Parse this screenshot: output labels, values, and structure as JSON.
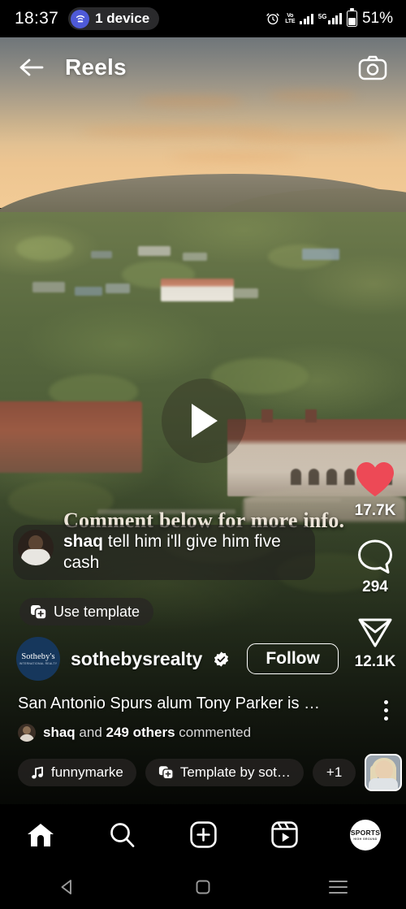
{
  "statusbar": {
    "time": "18:37",
    "cast_label": "1 device",
    "cast_icon": "cast-icon",
    "alarm_icon": "alarm-clock-icon",
    "volte_line1": "Vo",
    "volte_line2": "LTE",
    "network_type": "5G",
    "battery_percent": "51%"
  },
  "header": {
    "back_icon": "back-arrow-icon",
    "title": "Reels",
    "camera_icon": "camera-icon"
  },
  "player": {
    "play_icon": "play-icon",
    "burned_in_text": "Comment below for more info."
  },
  "actions": {
    "like": {
      "icon": "heart-filled-icon",
      "count": "17.7K",
      "color": "#ED4956"
    },
    "comment": {
      "icon": "comment-bubble-icon",
      "count": "294"
    },
    "share": {
      "icon": "share-paper-plane-icon",
      "count": "12.1K"
    },
    "more": {
      "icon": "more-vertical-icon"
    }
  },
  "pinned_comment": {
    "avatar": "shaq-avatar",
    "username": "shaq",
    "text": "tell him i'll give him five cash"
  },
  "use_template": {
    "icon": "template-icon",
    "label": "Use template"
  },
  "account": {
    "avatar": "sothebys-avatar",
    "avatar_text_main": "Sotheby's",
    "avatar_text_sub": "INTERNATIONAL REALTY",
    "username": "sothebysrealty",
    "verified_icon": "verified-badge-icon",
    "follow_label": "Follow"
  },
  "caption": {
    "text": "San Antonio Spurs alum Tony Parker is …"
  },
  "commenters": {
    "avatar": "commenter-avatar",
    "name": "shaq",
    "middle": " and ",
    "others": "249 others",
    "suffix": " commented"
  },
  "chips": [
    {
      "icon": "music-note-icon",
      "label": "funnymarke"
    },
    {
      "icon": "template-icon",
      "label": "Template by sot…"
    },
    {
      "icon": "",
      "label": "+1"
    }
  ],
  "thumbnail": {
    "name": "reel-thumbnail"
  },
  "bottom_nav": [
    {
      "name": "home",
      "icon": "home-filled-icon"
    },
    {
      "name": "search",
      "icon": "search-icon"
    },
    {
      "name": "create",
      "icon": "plus-square-icon"
    },
    {
      "name": "reels",
      "icon": "reels-icon"
    },
    {
      "name": "profile",
      "icon": "profile-avatar",
      "avatar_main": "SPORTS",
      "avatar_sub": "HIGH GROUND"
    }
  ],
  "system_nav": {
    "back_icon": "android-back-icon",
    "home_icon": "android-home-icon",
    "recents_icon": "android-recents-icon"
  },
  "colors": {
    "like_red": "#ED4956",
    "verified_blue": "#ffffff",
    "sothebys_navy": "#16375C"
  }
}
